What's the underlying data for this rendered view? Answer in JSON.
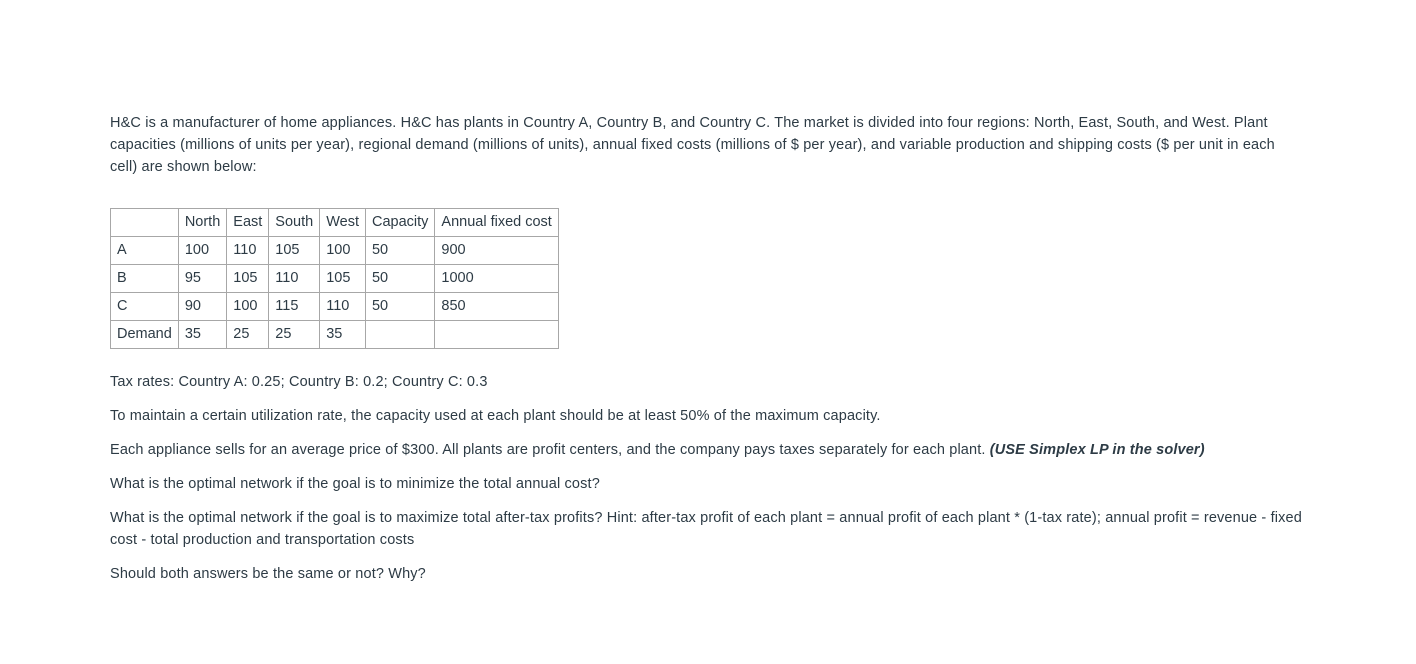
{
  "document": {
    "intro": {
      "line1": "H&C is a manufacturer of home appliances. H&C has plants in Country A, Country B, and Country C. The market is divided into four regions: North, East, South, and West. Plant capacities (millions of units per year), regional demand (millions of units), annual fixed costs (millions of $ per year), and variable production and shipping costs ($ per unit in each cell) are shown below:"
    },
    "table": {
      "headers": [
        "",
        "North",
        "East",
        "South",
        "West",
        "Capacity",
        "Annual fixed cost"
      ],
      "rows": [
        {
          "label": "A",
          "north": "100",
          "east": "110",
          "south": "105",
          "west": "100",
          "capacity": "50",
          "fixed_cost": "900"
        },
        {
          "label": "B",
          "north": "95",
          "east": "105",
          "south": "110",
          "west": "105",
          "capacity": "50",
          "fixed_cost": "1000"
        },
        {
          "label": "C",
          "north": "90",
          "east": "100",
          "south": "115",
          "west": "110",
          "capacity": "50",
          "fixed_cost": "850"
        },
        {
          "label": "Demand",
          "north": "35",
          "east": "25",
          "south": "25",
          "west": "35",
          "capacity": "",
          "fixed_cost": ""
        }
      ]
    },
    "paragraphs": {
      "tax_rates": "Tax rates: Country A: 0.25; Country B: 0.2; Country C: 0.3",
      "utilization": "To maintain a certain utilization rate, the capacity used at each plant should be at least 50% of the maximum capacity.",
      "price_plain": "Each appliance sells for an average price of $300. All plants are profit centers, and the company pays taxes separately for each plant.",
      "price_emphasis": "(USE Simplex LP in the solver)",
      "question_min_cost": "What is the optimal network if the goal is to minimize the total annual cost?",
      "question_max_profit": "What is the optimal network if the goal is to maximize total after-tax profits? Hint: after-tax profit of each plant = annual profit of each plant * (1-tax rate); annual profit = revenue - fixed cost - total production and transportation costs",
      "question_same": "Should both answers be the same or not? Why?"
    }
  },
  "chart_data": {
    "type": "table",
    "title": "Plant costs, capacities and regional demand",
    "columns": [
      "",
      "North",
      "East",
      "South",
      "West",
      "Capacity",
      "Annual fixed cost"
    ],
    "rows": [
      [
        "A",
        100,
        110,
        105,
        100,
        50,
        900
      ],
      [
        "B",
        95,
        105,
        110,
        105,
        50,
        1000
      ],
      [
        "C",
        90,
        100,
        115,
        110,
        50,
        850
      ],
      [
        "Demand",
        35,
        25,
        25,
        35,
        null,
        null
      ]
    ],
    "units": {
      "cells": "$ per unit (variable production and shipping cost)",
      "capacity": "millions of units per year",
      "demand": "millions of units",
      "annual_fixed_cost": "millions of $ per year"
    },
    "tax_rates": {
      "Country A": 0.25,
      "Country B": 0.2,
      "Country C": 0.3
    },
    "average_price": 300,
    "min_utilization": 0.5
  }
}
